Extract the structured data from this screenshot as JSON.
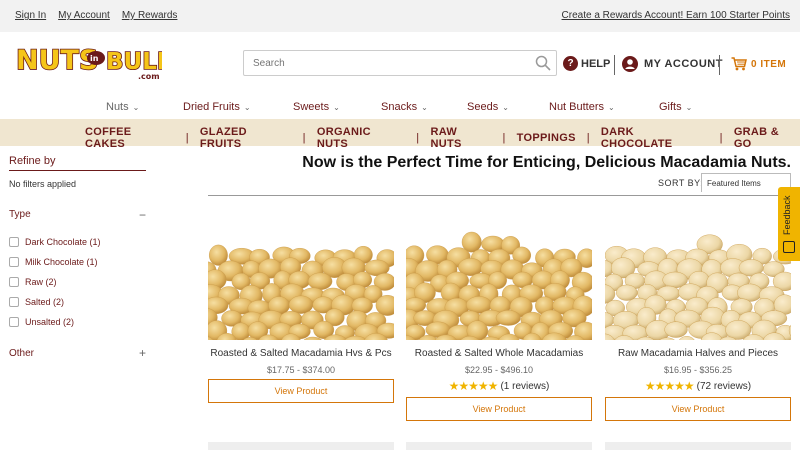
{
  "topbar": {
    "sign_in": "Sign In",
    "my_account": "My Account",
    "my_rewards": "My Rewards",
    "promo": "Create a Rewards Account! Earn 100 Starter Points"
  },
  "header": {
    "logo_text": "NUTS in BULK .com",
    "search_placeholder": "Search",
    "help": "HELP",
    "account": "MY ACCOUNT",
    "cart": "0 ITEM"
  },
  "nav": {
    "items": [
      {
        "label": "Nuts"
      },
      {
        "label": "Dried Fruits"
      },
      {
        "label": "Sweets"
      },
      {
        "label": "Snacks"
      },
      {
        "label": "Seeds"
      },
      {
        "label": "Nut Butters"
      },
      {
        "label": "Gifts"
      }
    ]
  },
  "subnav": {
    "items": [
      "COFFEE CAKES",
      "GLAZED FRUITS",
      "ORGANIC NUTS",
      "RAW NUTS",
      "TOPPINGS",
      "DARK CHOCOLATE",
      "GRAB & GO"
    ]
  },
  "sidebar": {
    "refine_by": "Refine by",
    "no_filters": "No filters applied",
    "type_heading": "Type",
    "type_toggle": "−",
    "filters": [
      "Dark Chocolate (1)",
      "Milk Chocolate (1)",
      "Raw (2)",
      "Salted (2)",
      "Unsalted (2)"
    ],
    "other_heading": "Other",
    "other_toggle": "+"
  },
  "main": {
    "title": "Now is the Perfect Time for Enticing, Delicious Macadamia Nuts.",
    "sort_label": "SORT BY:",
    "sort_value": "Featured Items"
  },
  "products": [
    {
      "name": "Roasted & Salted Macadamia Hvs & Pcs",
      "price": "$17.75 - $374.00",
      "reviews": "",
      "button": "View Product"
    },
    {
      "name": "Roasted & Salted Whole Macadamias",
      "price": "$22.95 - $496.10",
      "reviews": "(1 reviews)",
      "rating": 5,
      "button": "View Product"
    },
    {
      "name": "Raw Macadamia Halves and Pieces",
      "price": "$16.95 - $356.25",
      "reviews": "(72 reviews)",
      "rating": 5,
      "button": "View Product"
    }
  ],
  "feedback": {
    "label": "Feedback"
  },
  "colors": {
    "brand_maroon": "#6b1a1a",
    "accent_orange": "#d4760a",
    "star_gold": "#f0b400",
    "subnav_bg": "#f0e6d0"
  }
}
